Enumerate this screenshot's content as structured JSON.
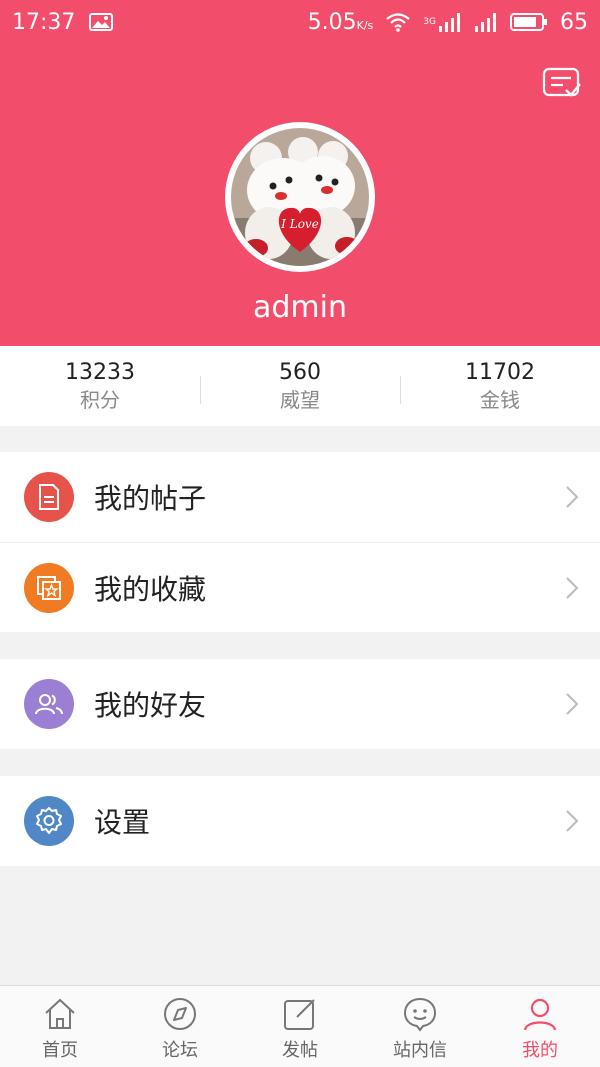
{
  "status_bar": {
    "time": "17:37",
    "speed": "5.05",
    "speed_unit": "K/s",
    "network": "3G",
    "battery": "65"
  },
  "profile": {
    "username": "admin"
  },
  "stats": [
    {
      "value": "13233",
      "label": "积分"
    },
    {
      "value": "560",
      "label": "威望"
    },
    {
      "value": "11702",
      "label": "金钱"
    }
  ],
  "menu": {
    "posts": {
      "label": "我的帖子",
      "icon": "document-icon",
      "color": "#e5534b"
    },
    "favorites": {
      "label": "我的收藏",
      "icon": "star-icon",
      "color": "#f07b22"
    },
    "friends": {
      "label": "我的好友",
      "icon": "friends-icon",
      "color": "#9b7fd4"
    },
    "settings": {
      "label": "设置",
      "icon": "gear-icon",
      "color": "#4f87c7"
    }
  },
  "tabs": [
    {
      "label": "首页",
      "icon": "home-icon"
    },
    {
      "label": "论坛",
      "icon": "compass-icon"
    },
    {
      "label": "发帖",
      "icon": "compose-icon"
    },
    {
      "label": "站内信",
      "icon": "smiley-icon"
    },
    {
      "label": "我的",
      "icon": "person-icon",
      "active": true
    }
  ],
  "colors": {
    "brand": "#f24e6c",
    "background": "#f2f2f2"
  }
}
